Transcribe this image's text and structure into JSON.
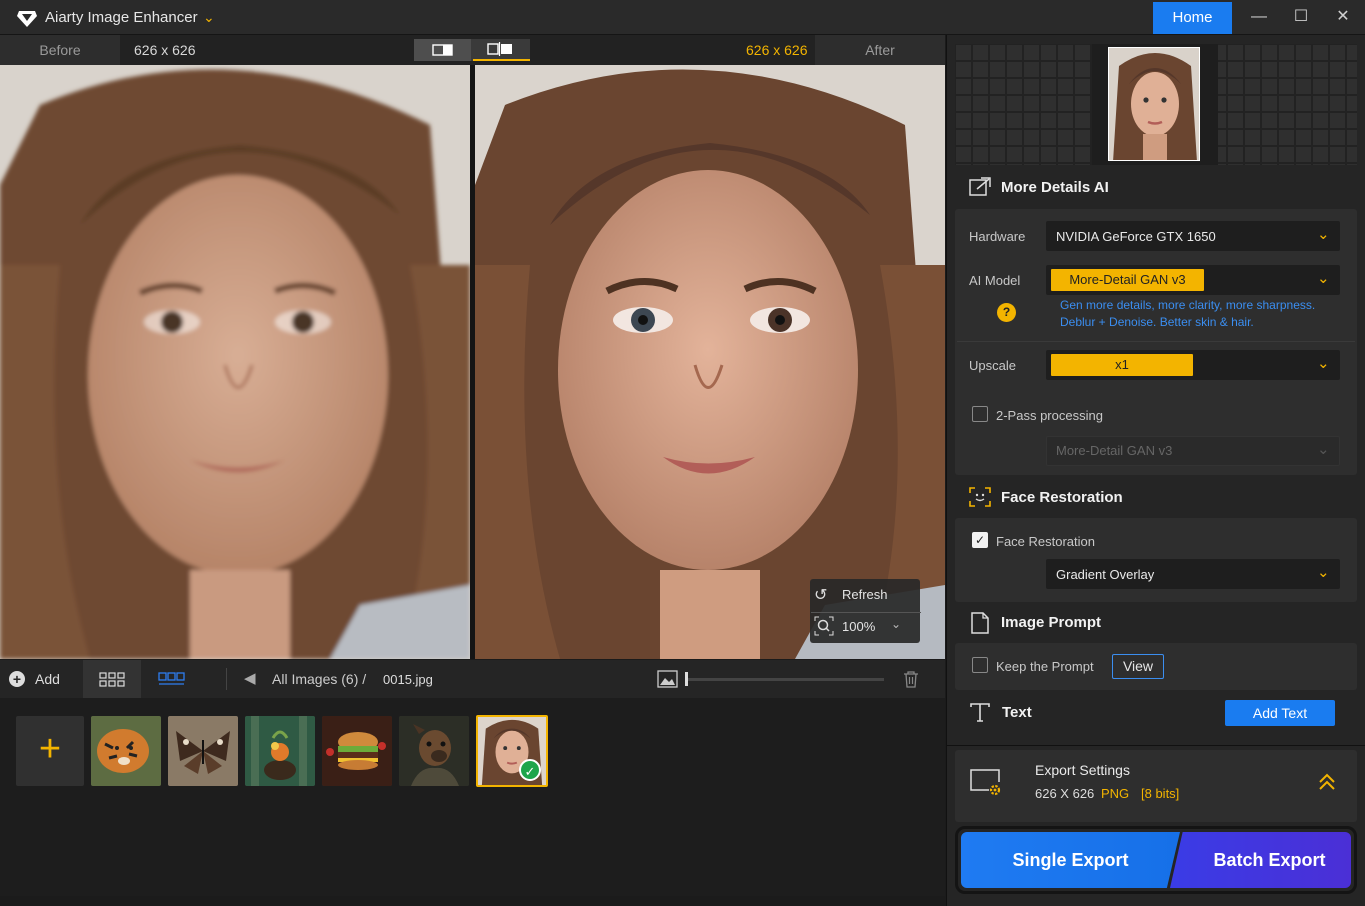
{
  "app": {
    "title": "Aiarty Image Enhancer",
    "home_label": "Home"
  },
  "compare": {
    "before_label": "Before",
    "before_size": "626 x 626",
    "after_size": "626 x 626",
    "after_label": "After"
  },
  "overlay": {
    "refresh_label": "Refresh",
    "zoom_label": "100%"
  },
  "toolbar": {
    "add_label": "Add",
    "breadcrumb": "All Images (6)  /",
    "current_file": "0015.jpg",
    "zoom_fraction": 0.0
  },
  "thumbnails": [
    {
      "name": "tiger"
    },
    {
      "name": "butterfly"
    },
    {
      "name": "forest-pot"
    },
    {
      "name": "burger"
    },
    {
      "name": "dog-warrior"
    },
    {
      "name": "portrait",
      "selected": true
    }
  ],
  "panel": {
    "more_details": {
      "title": "More Details AI",
      "hardware_label": "Hardware",
      "hardware_value": "NVIDIA GeForce GTX 1650",
      "model_label": "AI Model",
      "model_value": "More-Detail GAN  v3",
      "model_desc_1": "Gen more details, more clarity, more sharpness.",
      "model_desc_2": "Deblur + Denoise. Better skin & hair.",
      "upscale_label": "Upscale",
      "upscale_value": "x1",
      "twopass_label": "2-Pass processing",
      "twopass_model": "More-Detail GAN  v3"
    },
    "face": {
      "title": "Face Restoration",
      "checkbox_label": "Face Restoration",
      "mode_value": "Gradient Overlay"
    },
    "prompt": {
      "title": "Image Prompt",
      "keep_label": "Keep the Prompt",
      "view_label": "View"
    },
    "text": {
      "title": "Text",
      "add_label": "Add Text"
    },
    "export": {
      "title": "Export Settings",
      "size": "626 X 626",
      "format": "PNG",
      "bits": "[8 bits]"
    },
    "single_export": "Single Export",
    "batch_export": "Batch Export"
  },
  "colors": {
    "accent": "#f3b400",
    "primary": "#1a7cf0",
    "batch": "#4b2fd6"
  }
}
